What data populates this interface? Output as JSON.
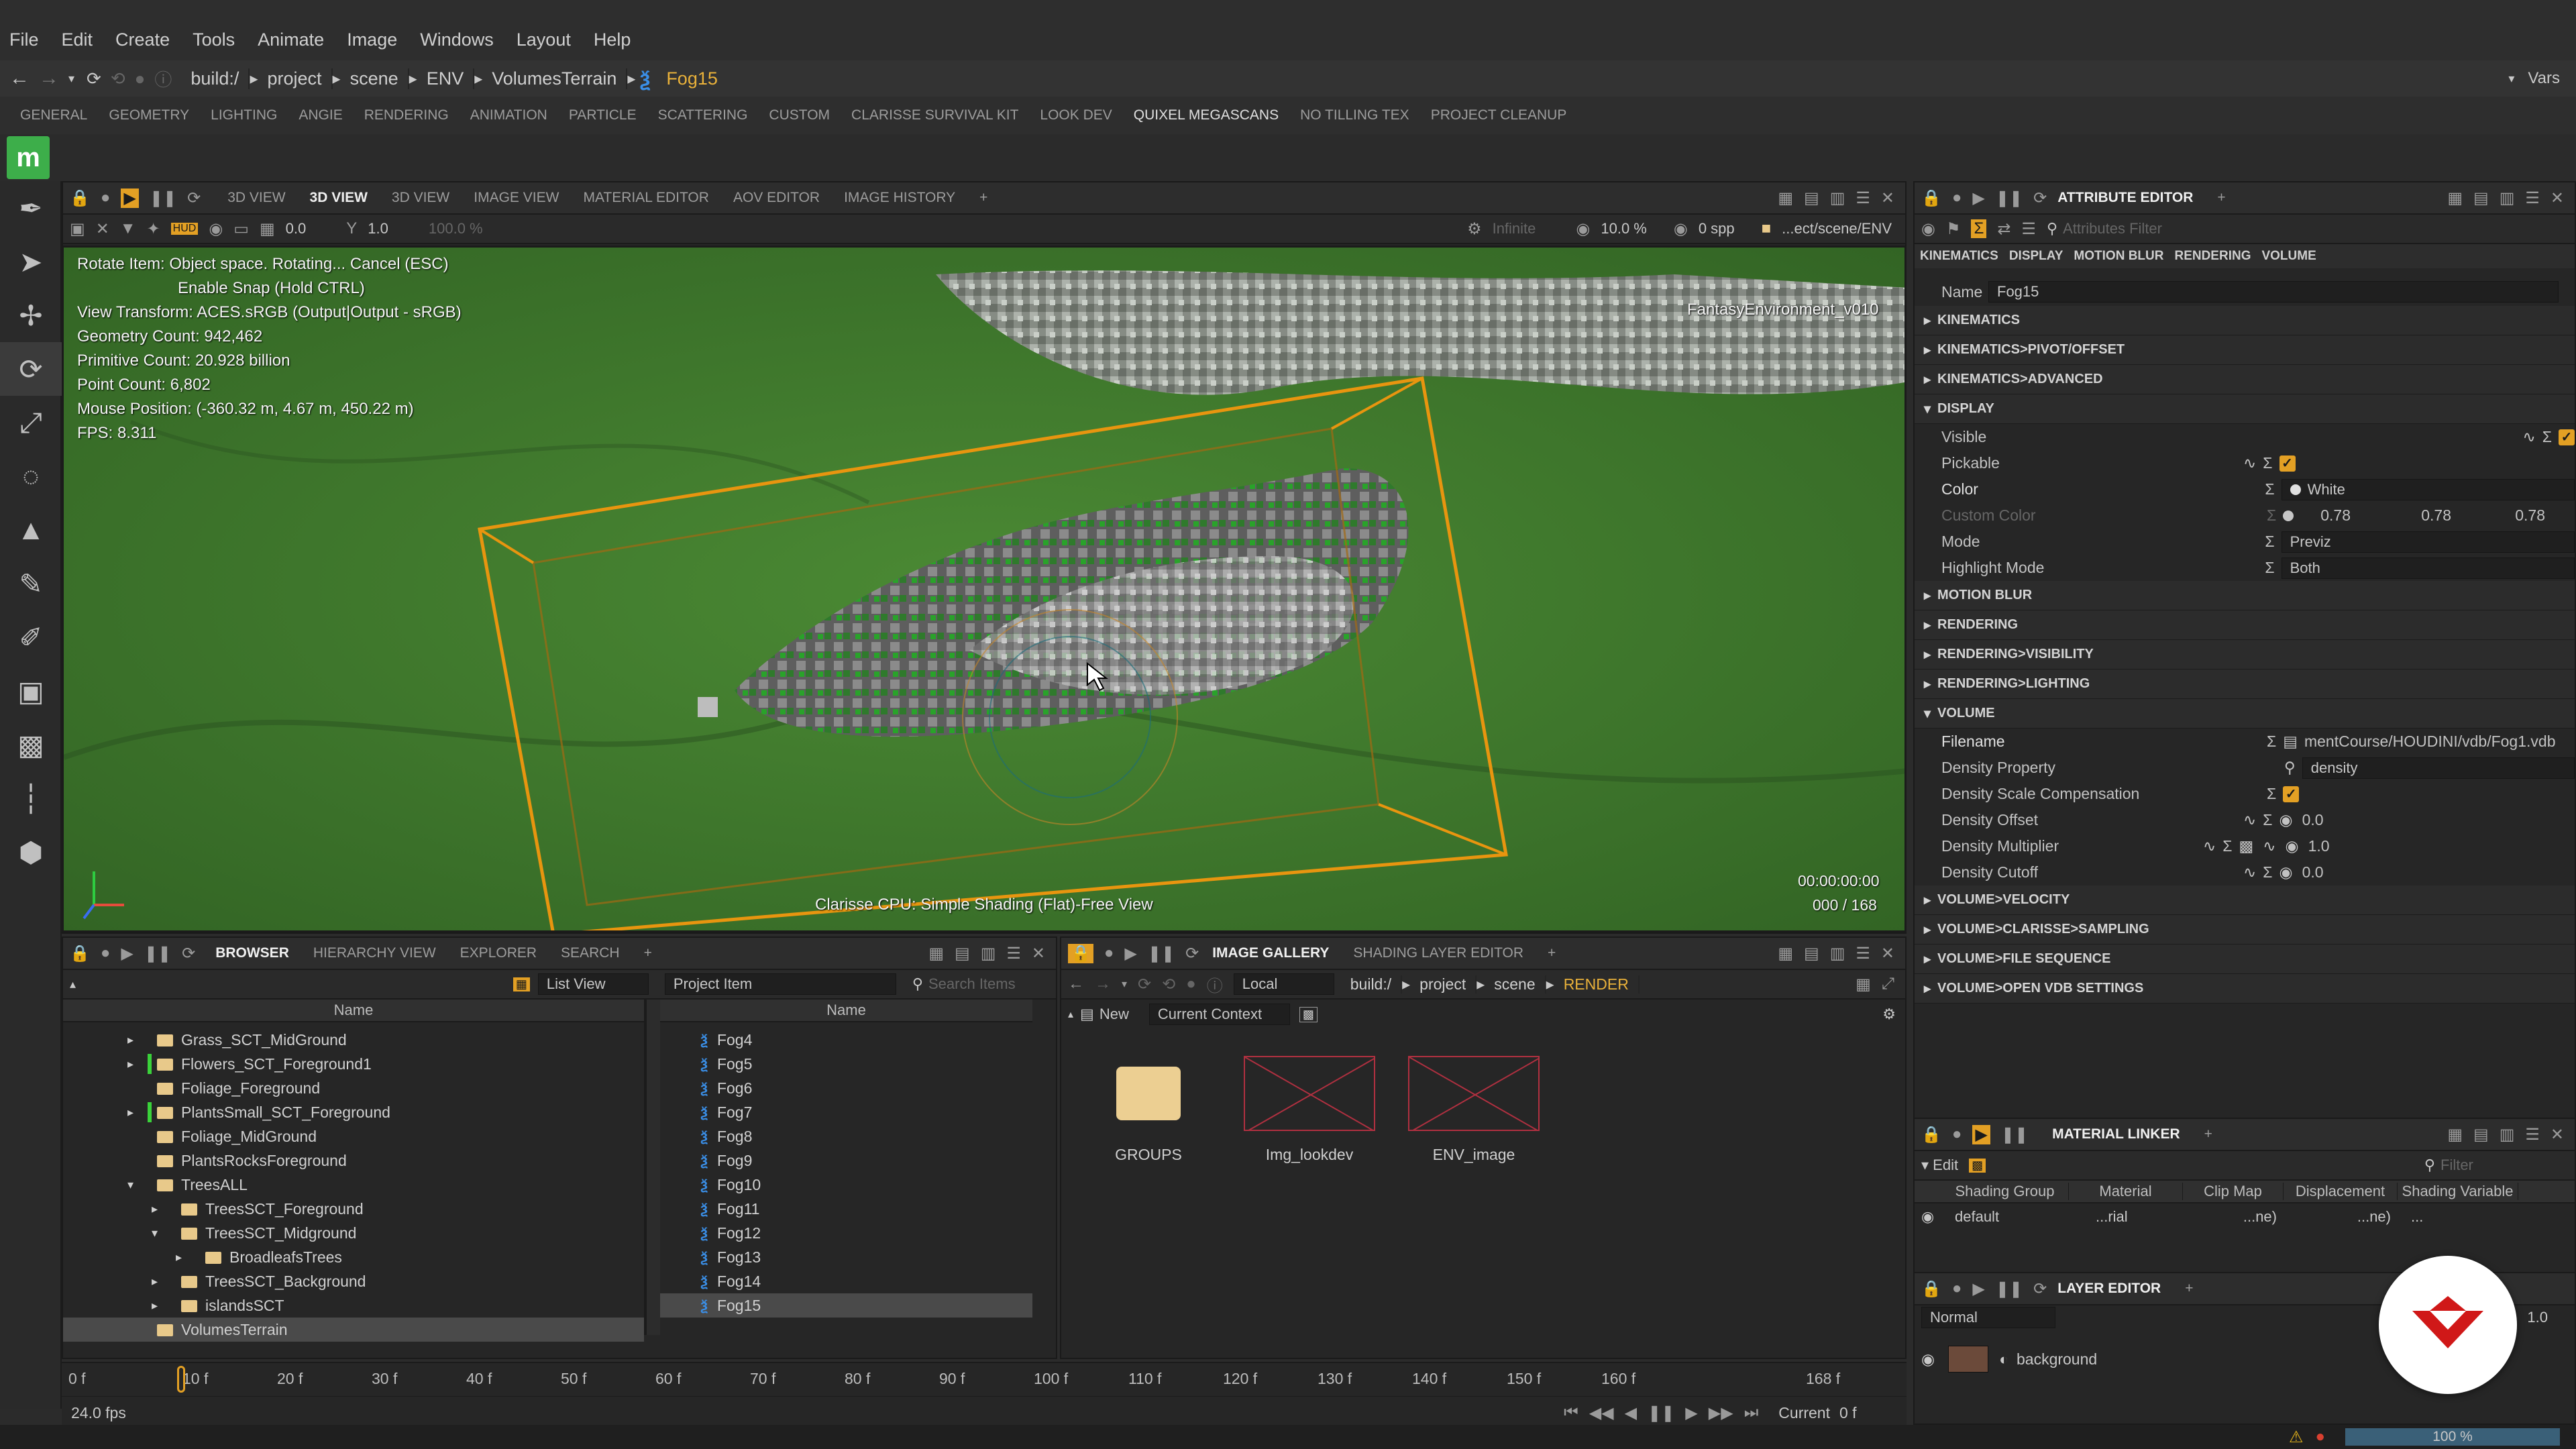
{
  "menu": [
    "File",
    "Edit",
    "Create",
    "Tools",
    "Animate",
    "Image",
    "Windows",
    "Layout",
    "Help"
  ],
  "path": {
    "items": [
      "build:/",
      "project",
      "scene",
      "ENV",
      "VolumesTerrain"
    ],
    "current": "Fog15",
    "vars": "Vars"
  },
  "shelf_tabs": [
    "GENERAL",
    "GEOMETRY",
    "LIGHTING",
    "ANGIE",
    "RENDERING",
    "ANIMATION",
    "PARTICLE",
    "SCATTERING",
    "CUSTOM",
    "CLARISSE SURVIVAL KIT",
    "LOOK DEV",
    "QUIXEL MEGASCANS",
    "NO TILLING TEX",
    "PROJECT CLEANUP"
  ],
  "shelf_selected": "QUIXEL MEGASCANS",
  "viewport_tabs": [
    "3D VIEW",
    "3D VIEW",
    "3D VIEW",
    "IMAGE VIEW",
    "MATERIAL EDITOR",
    "AOV EDITOR",
    "IMAGE HISTORY",
    "+"
  ],
  "viewport_tab_selected_index": 1,
  "viewport_toolbar": {
    "value1": "0.0",
    "value2": "1.0",
    "value3": "100.0 %",
    "infinite": "Infinite",
    "percent": "10.0 %",
    "spp": "0 spp",
    "path": "...ect/scene/ENV"
  },
  "hud": {
    "lines": [
      "Rotate Item: Object space. Rotating... Cancel (ESC)",
      "Enable Snap (Hold CTRL)",
      "View Transform: ACES.sRGB (Output|Output - sRGB)",
      "Geometry Count: 942,462",
      "Primitive Count: 20.928 billion",
      "Point Count: 6,802",
      "Mouse Position: (-360.32 m, 4.67 m, 450.22 m)",
      "FPS: 8.311"
    ],
    "camera_label": "FantasyEnvironment_v010",
    "render_mode": "Clarisse CPU: Simple Shading (Flat)-Free View",
    "timecode": "00:00:00:00",
    "frame": "000 / 168"
  },
  "attribute_editor": {
    "title": "ATTRIBUTE EDITOR",
    "filter_placeholder": "Attributes Filter",
    "subtabs": [
      "KINEMATICS",
      "DISPLAY",
      "MOTION BLUR",
      "RENDERING",
      "VOLUME"
    ],
    "name_label": "Name",
    "name_value": "Fog15",
    "sections_top": [
      "KINEMATICS",
      "KINEMATICS>PIVOT/OFFSET",
      "KINEMATICS>ADVANCED"
    ],
    "display_section": "DISPLAY",
    "display_rows": {
      "visible": "Visible",
      "pickable": "Pickable",
      "color": "Color",
      "color_value": "White",
      "custom_color": "Custom Color",
      "c1": "0.78",
      "c2": "0.78",
      "c3": "0.78",
      "mode": "Mode",
      "mode_value": "Previz",
      "highlight": "Highlight Mode",
      "highlight_value": "Both"
    },
    "sections_mid": [
      "MOTION BLUR",
      "RENDERING",
      "RENDERING>VISIBILITY",
      "RENDERING>LIGHTING"
    ],
    "volume_section": "VOLUME",
    "volume_rows": {
      "filename": "Filename",
      "filename_value": "mentCourse/HOUDINI/vdb/Fog1.vdb",
      "density_property": "Density Property",
      "density_property_value": "density",
      "density_scale": "Density Scale Compensation",
      "density_offset": "Density Offset",
      "density_offset_value": "0.0",
      "density_multiplier": "Density Multiplier",
      "density_multiplier_value": "1.0",
      "density_cutoff": "Density Cutoff",
      "density_cutoff_value": "0.0"
    },
    "sections_bottom": [
      "VOLUME>VELOCITY",
      "VOLUME>CLARISSE>SAMPLING",
      "VOLUME>FILE SEQUENCE",
      "VOLUME>OPEN VDB SETTINGS"
    ]
  },
  "material_linker": {
    "title": "MATERIAL LINKER",
    "edit": "Edit",
    "filter_placeholder": "Filter",
    "columns": [
      "Shading Group",
      "Material",
      "Clip Map",
      "Displacement",
      "Shading Variable"
    ],
    "row": {
      "group": "default",
      "material": "...rial",
      "clip": "...ne)",
      "disp": "...ne)",
      "var": "..."
    }
  },
  "layer_editor": {
    "title": "LAYER EDITOR",
    "blend": "Normal",
    "opacity": "1.0",
    "layer": "background"
  },
  "browser": {
    "tabs": [
      "BROWSER",
      "HIERARCHY VIEW",
      "EXPLORER",
      "SEARCH",
      "+"
    ],
    "list_view": "List View",
    "project_item": "Project Item",
    "search_placeholder": "Search Items",
    "col_name": "Name",
    "tree": [
      {
        "label": "Grass_SCT_MidGround",
        "indent": 1,
        "arrow": "▸",
        "marker": false
      },
      {
        "label": "Flowers_SCT_Foreground1",
        "indent": 1,
        "arrow": "▸",
        "marker": true
      },
      {
        "label": "Foliage_Foreground",
        "indent": 1,
        "arrow": "",
        "marker": false
      },
      {
        "label": "PlantsSmall_SCT_Foreground",
        "indent": 1,
        "arrow": "▸",
        "marker": true
      },
      {
        "label": "Foliage_MidGround",
        "indent": 1,
        "arrow": "",
        "marker": false
      },
      {
        "label": "PlantsRocksForeground",
        "indent": 1,
        "arrow": "",
        "marker": false
      },
      {
        "label": "TreesALL",
        "indent": 1,
        "arrow": "▾",
        "marker": false
      },
      {
        "label": "TreesSCT_Foreground",
        "indent": 2,
        "arrow": "▸",
        "marker": false
      },
      {
        "label": "TreesSCT_Midground",
        "indent": 2,
        "arrow": "▾",
        "marker": false
      },
      {
        "label": "BroadleafsTrees",
        "indent": 3,
        "arrow": "▸",
        "marker": false
      },
      {
        "label": "TreesSCT_Background",
        "indent": 2,
        "arrow": "▸",
        "marker": false
      },
      {
        "label": "islandsSCT",
        "indent": 2,
        "arrow": "▸",
        "marker": false
      },
      {
        "label": "VolumesTerrain",
        "indent": 1,
        "arrow": "",
        "marker": false,
        "selected": true
      }
    ],
    "items": [
      "Fog4",
      "Fog5",
      "Fog6",
      "Fog7",
      "Fog8",
      "Fog9",
      "Fog10",
      "Fog11",
      "Fog12",
      "Fog13",
      "Fog14",
      "Fog15"
    ],
    "selected_item": "Fog15"
  },
  "image_gallery": {
    "tabs": [
      "IMAGE GALLERY",
      "SHADING LAYER EDITOR",
      "+"
    ],
    "context": "Local",
    "path": [
      "build:/",
      "project",
      "scene"
    ],
    "path_current": "RENDER",
    "new_label": "New",
    "current_context": "Current Context",
    "items": [
      {
        "label": "GROUPS",
        "type": "folder"
      },
      {
        "label": "Img_lookdev",
        "type": "image"
      },
      {
        "label": "ENV_image",
        "type": "image"
      }
    ]
  },
  "timeline": {
    "start": "0 f",
    "ticks": [
      "0 f",
      "10 f",
      "20 f",
      "30 f",
      "40 f",
      "50 f",
      "60 f",
      "70 f",
      "80 f",
      "90 f",
      "100 f",
      "110 f",
      "120 f",
      "130 f",
      "140 f",
      "150 f",
      "160 f"
    ],
    "end": "168 f",
    "fps": "24.0 fps",
    "current_label": "Current",
    "current_value": "0 f"
  },
  "status": {
    "zoom": "100 %"
  },
  "colors": {
    "accent": "#e3a024",
    "selection_box": "#e8950f",
    "fog_icon": "#3a8fe8",
    "grass": "#3f7a2a"
  }
}
